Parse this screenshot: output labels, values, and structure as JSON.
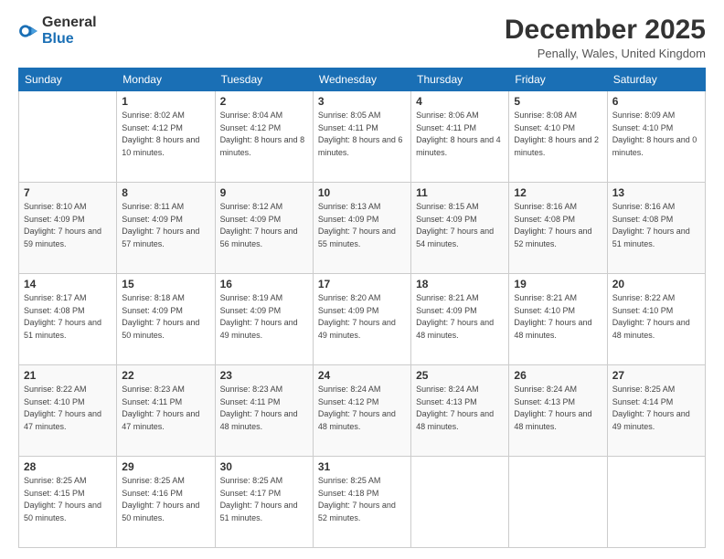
{
  "header": {
    "logo_line1": "General",
    "logo_line2": "Blue",
    "month": "December 2025",
    "location": "Penally, Wales, United Kingdom"
  },
  "weekdays": [
    "Sunday",
    "Monday",
    "Tuesday",
    "Wednesday",
    "Thursday",
    "Friday",
    "Saturday"
  ],
  "weeks": [
    [
      {
        "day": "",
        "sunrise": "",
        "sunset": "",
        "daylight": ""
      },
      {
        "day": "1",
        "sunrise": "Sunrise: 8:02 AM",
        "sunset": "Sunset: 4:12 PM",
        "daylight": "Daylight: 8 hours and 10 minutes."
      },
      {
        "day": "2",
        "sunrise": "Sunrise: 8:04 AM",
        "sunset": "Sunset: 4:12 PM",
        "daylight": "Daylight: 8 hours and 8 minutes."
      },
      {
        "day": "3",
        "sunrise": "Sunrise: 8:05 AM",
        "sunset": "Sunset: 4:11 PM",
        "daylight": "Daylight: 8 hours and 6 minutes."
      },
      {
        "day": "4",
        "sunrise": "Sunrise: 8:06 AM",
        "sunset": "Sunset: 4:11 PM",
        "daylight": "Daylight: 8 hours and 4 minutes."
      },
      {
        "day": "5",
        "sunrise": "Sunrise: 8:08 AM",
        "sunset": "Sunset: 4:10 PM",
        "daylight": "Daylight: 8 hours and 2 minutes."
      },
      {
        "day": "6",
        "sunrise": "Sunrise: 8:09 AM",
        "sunset": "Sunset: 4:10 PM",
        "daylight": "Daylight: 8 hours and 0 minutes."
      }
    ],
    [
      {
        "day": "7",
        "sunrise": "Sunrise: 8:10 AM",
        "sunset": "Sunset: 4:09 PM",
        "daylight": "Daylight: 7 hours and 59 minutes."
      },
      {
        "day": "8",
        "sunrise": "Sunrise: 8:11 AM",
        "sunset": "Sunset: 4:09 PM",
        "daylight": "Daylight: 7 hours and 57 minutes."
      },
      {
        "day": "9",
        "sunrise": "Sunrise: 8:12 AM",
        "sunset": "Sunset: 4:09 PM",
        "daylight": "Daylight: 7 hours and 56 minutes."
      },
      {
        "day": "10",
        "sunrise": "Sunrise: 8:13 AM",
        "sunset": "Sunset: 4:09 PM",
        "daylight": "Daylight: 7 hours and 55 minutes."
      },
      {
        "day": "11",
        "sunrise": "Sunrise: 8:15 AM",
        "sunset": "Sunset: 4:09 PM",
        "daylight": "Daylight: 7 hours and 54 minutes."
      },
      {
        "day": "12",
        "sunrise": "Sunrise: 8:16 AM",
        "sunset": "Sunset: 4:08 PM",
        "daylight": "Daylight: 7 hours and 52 minutes."
      },
      {
        "day": "13",
        "sunrise": "Sunrise: 8:16 AM",
        "sunset": "Sunset: 4:08 PM",
        "daylight": "Daylight: 7 hours and 51 minutes."
      }
    ],
    [
      {
        "day": "14",
        "sunrise": "Sunrise: 8:17 AM",
        "sunset": "Sunset: 4:08 PM",
        "daylight": "Daylight: 7 hours and 51 minutes."
      },
      {
        "day": "15",
        "sunrise": "Sunrise: 8:18 AM",
        "sunset": "Sunset: 4:09 PM",
        "daylight": "Daylight: 7 hours and 50 minutes."
      },
      {
        "day": "16",
        "sunrise": "Sunrise: 8:19 AM",
        "sunset": "Sunset: 4:09 PM",
        "daylight": "Daylight: 7 hours and 49 minutes."
      },
      {
        "day": "17",
        "sunrise": "Sunrise: 8:20 AM",
        "sunset": "Sunset: 4:09 PM",
        "daylight": "Daylight: 7 hours and 49 minutes."
      },
      {
        "day": "18",
        "sunrise": "Sunrise: 8:21 AM",
        "sunset": "Sunset: 4:09 PM",
        "daylight": "Daylight: 7 hours and 48 minutes."
      },
      {
        "day": "19",
        "sunrise": "Sunrise: 8:21 AM",
        "sunset": "Sunset: 4:10 PM",
        "daylight": "Daylight: 7 hours and 48 minutes."
      },
      {
        "day": "20",
        "sunrise": "Sunrise: 8:22 AM",
        "sunset": "Sunset: 4:10 PM",
        "daylight": "Daylight: 7 hours and 48 minutes."
      }
    ],
    [
      {
        "day": "21",
        "sunrise": "Sunrise: 8:22 AM",
        "sunset": "Sunset: 4:10 PM",
        "daylight": "Daylight: 7 hours and 47 minutes."
      },
      {
        "day": "22",
        "sunrise": "Sunrise: 8:23 AM",
        "sunset": "Sunset: 4:11 PM",
        "daylight": "Daylight: 7 hours and 47 minutes."
      },
      {
        "day": "23",
        "sunrise": "Sunrise: 8:23 AM",
        "sunset": "Sunset: 4:11 PM",
        "daylight": "Daylight: 7 hours and 48 minutes."
      },
      {
        "day": "24",
        "sunrise": "Sunrise: 8:24 AM",
        "sunset": "Sunset: 4:12 PM",
        "daylight": "Daylight: 7 hours and 48 minutes."
      },
      {
        "day": "25",
        "sunrise": "Sunrise: 8:24 AM",
        "sunset": "Sunset: 4:13 PM",
        "daylight": "Daylight: 7 hours and 48 minutes."
      },
      {
        "day": "26",
        "sunrise": "Sunrise: 8:24 AM",
        "sunset": "Sunset: 4:13 PM",
        "daylight": "Daylight: 7 hours and 48 minutes."
      },
      {
        "day": "27",
        "sunrise": "Sunrise: 8:25 AM",
        "sunset": "Sunset: 4:14 PM",
        "daylight": "Daylight: 7 hours and 49 minutes."
      }
    ],
    [
      {
        "day": "28",
        "sunrise": "Sunrise: 8:25 AM",
        "sunset": "Sunset: 4:15 PM",
        "daylight": "Daylight: 7 hours and 50 minutes."
      },
      {
        "day": "29",
        "sunrise": "Sunrise: 8:25 AM",
        "sunset": "Sunset: 4:16 PM",
        "daylight": "Daylight: 7 hours and 50 minutes."
      },
      {
        "day": "30",
        "sunrise": "Sunrise: 8:25 AM",
        "sunset": "Sunset: 4:17 PM",
        "daylight": "Daylight: 7 hours and 51 minutes."
      },
      {
        "day": "31",
        "sunrise": "Sunrise: 8:25 AM",
        "sunset": "Sunset: 4:18 PM",
        "daylight": "Daylight: 7 hours and 52 minutes."
      },
      {
        "day": "",
        "sunrise": "",
        "sunset": "",
        "daylight": ""
      },
      {
        "day": "",
        "sunrise": "",
        "sunset": "",
        "daylight": ""
      },
      {
        "day": "",
        "sunrise": "",
        "sunset": "",
        "daylight": ""
      }
    ]
  ]
}
